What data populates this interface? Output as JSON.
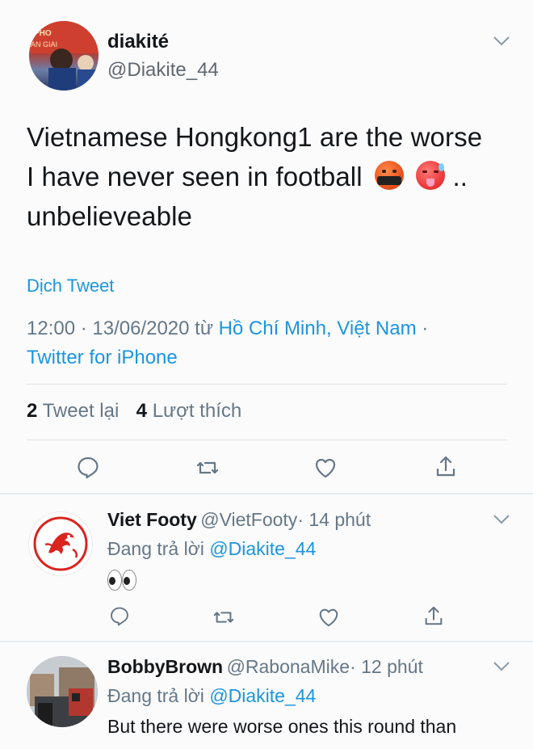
{
  "main_tweet": {
    "display_name": "diakité",
    "handle": "@Diakite_44",
    "text_line1": "Vietnamese Hongkong1 are the worse",
    "text_line2": "I have never seen in football",
    "text_line3": "unbelieveable",
    "emoji_trailing": "..",
    "translate_label": "Dịch Tweet",
    "timestamp": "12:00 · 13/06/2020 từ",
    "location": "Hồ Chí Minh, Việt Nam",
    "location_suffix": "·",
    "source": "Twitter for iPhone",
    "retweet_count": "2",
    "retweet_label": "Tweet lại",
    "like_count": "4",
    "like_label": "Lượt thích"
  },
  "replies": [
    {
      "display_name": "Viet Footy",
      "handle": "@VietFooty",
      "time": "· 14 phút",
      "replying_prefix": "Đang trả lời",
      "replying_to": "@Diakite_44",
      "text": "👀"
    },
    {
      "display_name": "BobbyBrown",
      "handle": "@RabonaMike",
      "time": "· 12 phút",
      "replying_prefix": "Đang trả lời",
      "replying_to": "@Diakite_44",
      "text": "But there were worse ones this round than"
    }
  ],
  "colors": {
    "link_blue": "#1b95e0",
    "text_dark": "#14171a",
    "text_grey": "#657786",
    "divider": "#e1e4e8"
  },
  "icons": [
    "reply-icon",
    "retweet-icon",
    "like-icon",
    "share-icon",
    "chevron-down-icon"
  ]
}
